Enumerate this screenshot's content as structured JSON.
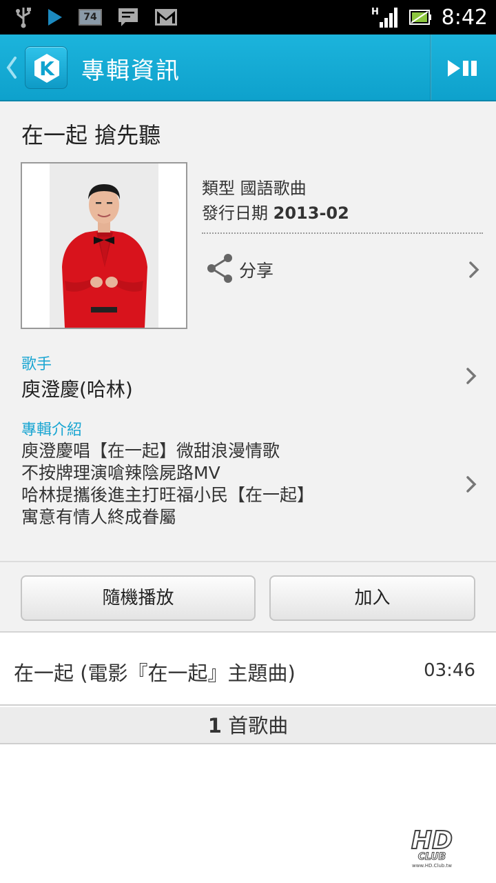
{
  "status_bar": {
    "time": "8:42",
    "notification_badge": "74",
    "network_label": "H",
    "icons": [
      "usb-icon",
      "play-store-icon",
      "battery-badge-icon",
      "message-icon",
      "gmail-icon",
      "signal-icon",
      "battery-icon"
    ]
  },
  "action_bar": {
    "title": "專輯資訊",
    "logo_letter": "K",
    "colors": {
      "bar": "#1cb4dc",
      "accent": "#1ba6d2"
    }
  },
  "album": {
    "title": "在一起 搶先聽",
    "genre_label": "類型",
    "genre_value": "國語歌曲",
    "release_label": "發行日期",
    "release_value": "2013-02",
    "share_label": "分享"
  },
  "artist": {
    "section_label": "歌手",
    "name": "庾澄慶(哈林)"
  },
  "intro": {
    "section_label": "專輯介紹",
    "lines": [
      "庾澄慶唱【在一起】微甜浪漫情歌",
      "不按牌理演嗆辣陰屍路MV",
      "哈林提攜後進主打旺福小民【在一起】",
      "寓意有情人終成眷屬"
    ]
  },
  "buttons": {
    "shuffle": "隨機播放",
    "add": "加入"
  },
  "tracks": [
    {
      "title": "在一起 (電影『在一起』主題曲)",
      "duration": "03:46"
    }
  ],
  "track_count": {
    "number": "1",
    "suffix": "首歌曲"
  },
  "watermark": {
    "main": "HD",
    "sub": "CLUB",
    "url": "www.HD.Club.tw"
  }
}
